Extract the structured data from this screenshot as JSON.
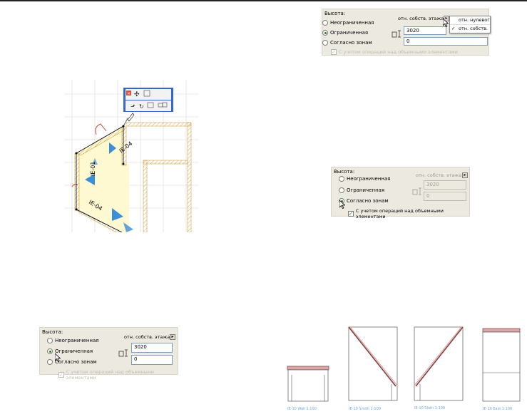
{
  "panels": {
    "height_label": "Высота:",
    "ref_label": "отн. собств. этажа",
    "opt_unlimited": "Неограниченная",
    "opt_limited": "Ограниченная",
    "opt_zones": "Согласно зонам",
    "height_value": "3020",
    "offset_value": "0",
    "checkbox_label": "С учетом операций над объемными элементами"
  },
  "popup": {
    "item_zero": "отн. нулевог",
    "item_own": "отн. собств."
  },
  "plan": {
    "wall_label_a": "IE-04",
    "wall_label_b": "IE-01",
    "wall_label_c": "IE-04"
  },
  "elevations": [
    {
      "caption": "IE-10   Wall   1:100"
    },
    {
      "caption": "IE-10   Smith   1:100"
    },
    {
      "caption": "IE-10   Sloth   1:100"
    },
    {
      "caption": "IE-10   East   1:100"
    }
  ]
}
